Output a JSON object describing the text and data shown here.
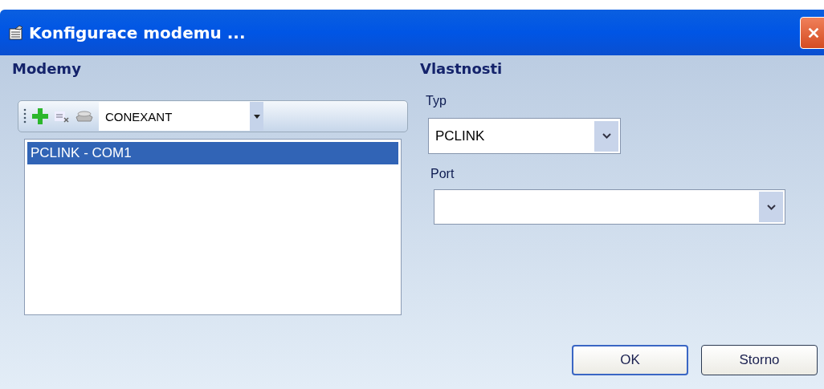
{
  "window": {
    "title": "Konfigurace modemu ..."
  },
  "modems": {
    "heading": "Modemy",
    "toolbar": {
      "dropdown_value": "CONEXANT"
    },
    "items": [
      {
        "label": "PCLINK - COM1",
        "selected": true
      }
    ]
  },
  "properties": {
    "heading": "Vlastnosti",
    "type_label": "Typ",
    "type_value": "PCLINK",
    "port_label": "Port"
  },
  "buttons": [
    {
      "label": "OK",
      "default": true
    },
    {
      "label": "Storno",
      "default": false
    }
  ]
}
